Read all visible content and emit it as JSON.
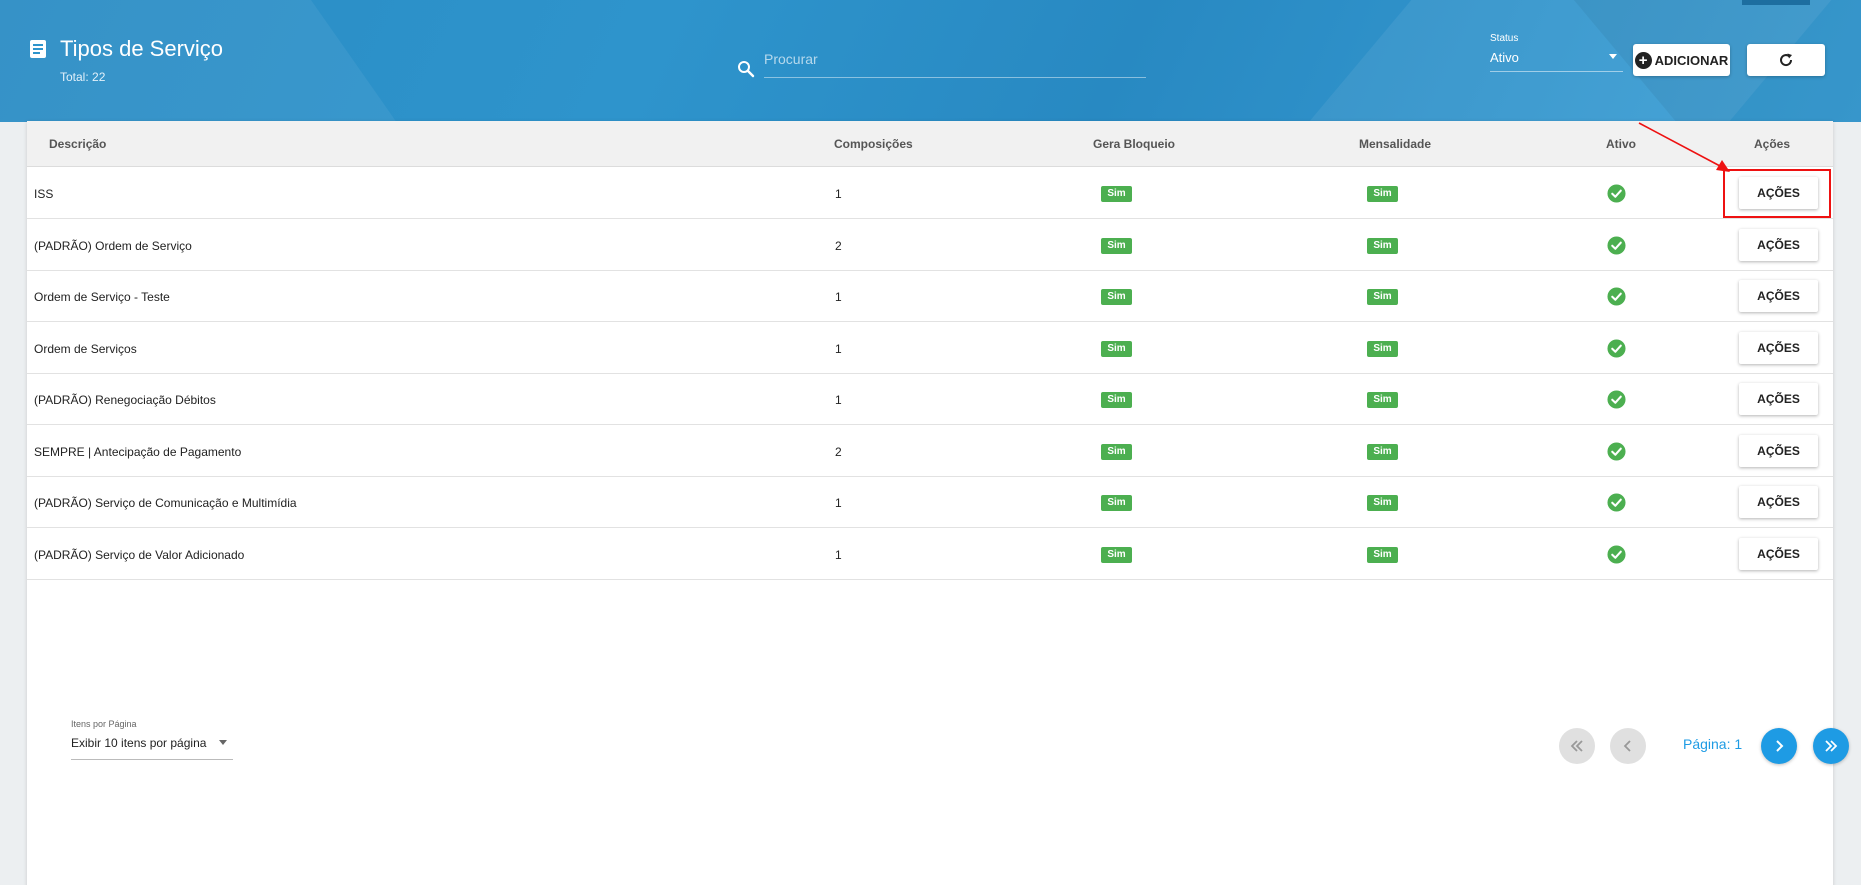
{
  "header": {
    "title": "Tipos de Serviço",
    "total": "Total: 22",
    "search_placeholder": "Procurar",
    "status_label": "Status",
    "status_value": "Ativo",
    "add_label": "ADICIONAR"
  },
  "table": {
    "columns": [
      "Descrição",
      "Composições",
      "Gera Bloqueio",
      "Mensalidade",
      "Ativo",
      "Ações"
    ],
    "action_label": "AÇÕES",
    "rows": [
      {
        "descricao": "ISS",
        "composicoes": "1",
        "gera_bloqueio": "Sim",
        "mensalidade": "Sim"
      },
      {
        "descricao": "(PADRÃO) Ordem de Serviço",
        "composicoes": "2",
        "gera_bloqueio": "Sim",
        "mensalidade": "Sim"
      },
      {
        "descricao": "Ordem de Serviço - Teste",
        "composicoes": "1",
        "gera_bloqueio": "Sim",
        "mensalidade": "Sim"
      },
      {
        "descricao": "Ordem de Serviços",
        "composicoes": "1",
        "gera_bloqueio": "Sim",
        "mensalidade": "Sim"
      },
      {
        "descricao": "(PADRÃO) Renegociação Débitos",
        "composicoes": "1",
        "gera_bloqueio": "Sim",
        "mensalidade": "Sim"
      },
      {
        "descricao": "SEMPRE | Antecipação de Pagamento",
        "composicoes": "2",
        "gera_bloqueio": "Sim",
        "mensalidade": "Sim"
      },
      {
        "descricao": "(PADRÃO) Serviço de Comunicação e Multimídia",
        "composicoes": "1",
        "gera_bloqueio": "Sim",
        "mensalidade": "Sim"
      },
      {
        "descricao": "(PADRÃO) Serviço de Valor Adicionado",
        "composicoes": "1",
        "gera_bloqueio": "Sim",
        "mensalidade": "Sim"
      }
    ]
  },
  "footer": {
    "items_per_page_label": "Itens por Página",
    "items_per_page_value": "Exibir 10 itens por página",
    "page_label": "Página: 1"
  },
  "colors": {
    "header_blue": "#2e94cc",
    "badge_green": "#4caf50",
    "pagination_blue": "#1e9be4",
    "highlight_red": "#ee1111"
  },
  "icons": [
    "document-icon",
    "search-icon",
    "plus-circle-icon",
    "refresh-icon",
    "check-circle-icon",
    "first-page-icon",
    "prev-page-icon",
    "next-page-icon",
    "last-page-icon"
  ]
}
